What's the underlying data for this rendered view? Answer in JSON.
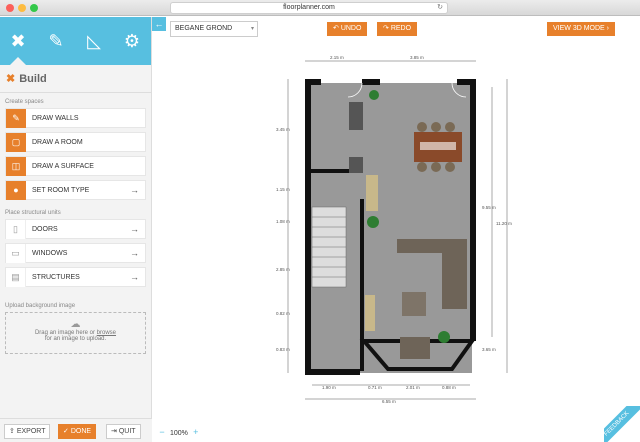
{
  "browser": {
    "url": "floorplanner.com",
    "reload_icon": "reload-icon"
  },
  "sidebar": {
    "tools": [
      "build-icon",
      "paint-brush-icon",
      "measure-triangle-icon",
      "gear-icon"
    ],
    "section_title": "Build",
    "groups": [
      {
        "label": "Create spaces",
        "items": [
          {
            "label": "DRAW WALLS",
            "icon": "pencil-icon"
          },
          {
            "label": "DRAW A ROOM",
            "icon": "room-icon"
          },
          {
            "label": "DRAW A SURFACE",
            "icon": "surface-icon"
          },
          {
            "label": "SET ROOM TYPE",
            "icon": "pin-icon"
          }
        ]
      },
      {
        "label": "Place structural units",
        "items": [
          {
            "label": "DOORS",
            "icon": "door-icon"
          },
          {
            "label": "WINDOWS",
            "icon": "window-icon"
          },
          {
            "label": "STRUCTURES",
            "icon": "stairs-icon"
          }
        ]
      }
    ],
    "upload": {
      "label": "Upload background image",
      "text_before": "Drag an image here or ",
      "link": "browse",
      "text_after": "for an image to upload."
    },
    "bottom": {
      "export": "EXPORT",
      "done": "DONE",
      "quit": "QUIT"
    }
  },
  "main": {
    "floor": "BEGANE GROND",
    "undo": "UNDO",
    "redo": "REDO",
    "view3d": "VIEW 3D MODE",
    "zoom": "100%",
    "feedback": "FEEDBACK"
  },
  "dimensions": {
    "top": [
      "2.15 m",
      "3.85 m"
    ],
    "left": [
      "3.45 m",
      "1.15 m",
      "1.08 m",
      "2.85 m",
      "0.82 m",
      "0.83 m"
    ],
    "right": [
      "9.55 m",
      "11.20 m",
      "3.65 m"
    ],
    "bottom": [
      "1.90 m",
      "0.71 m",
      "2.01 m",
      "0.88 m",
      "6.55 m"
    ]
  },
  "colors": {
    "accent": "#e7802b",
    "brand": "#57bfe0",
    "floor": "#999999",
    "wall": "#111111"
  }
}
